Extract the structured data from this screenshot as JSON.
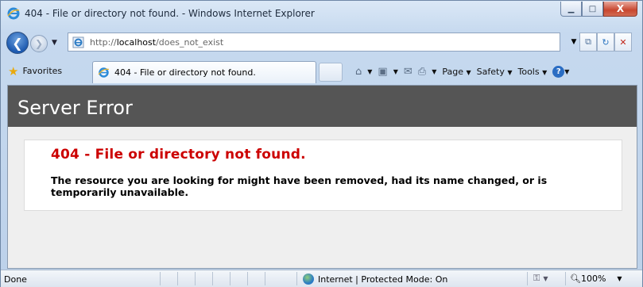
{
  "window": {
    "title": "404 - File or directory not found. - Windows Internet Explorer",
    "minimize_glyph": "▁",
    "maximize_glyph": "□",
    "close_glyph": "X"
  },
  "address": {
    "url_prefix": "http://",
    "url_host": "localhost",
    "url_path": "/does_not_exist"
  },
  "favorites": {
    "label": "Favorites"
  },
  "tab": {
    "label": "404 - File or directory not found."
  },
  "commands": {
    "page_label": "Page",
    "safety_label": "Safety",
    "tools_label": "Tools",
    "help_glyph": "?"
  },
  "page": {
    "header": "Server Error",
    "error_title": "404 - File or directory not found.",
    "error_message": "The resource you are looking for might have been removed, had its name changed, or is temporarily unavailable."
  },
  "status": {
    "text": "Done",
    "zone": "Internet | Protected Mode: On",
    "zoom": "100%"
  },
  "colors": {
    "header_band": "#555555",
    "error_title": "#cc0000",
    "content_bg": "#efefef"
  }
}
